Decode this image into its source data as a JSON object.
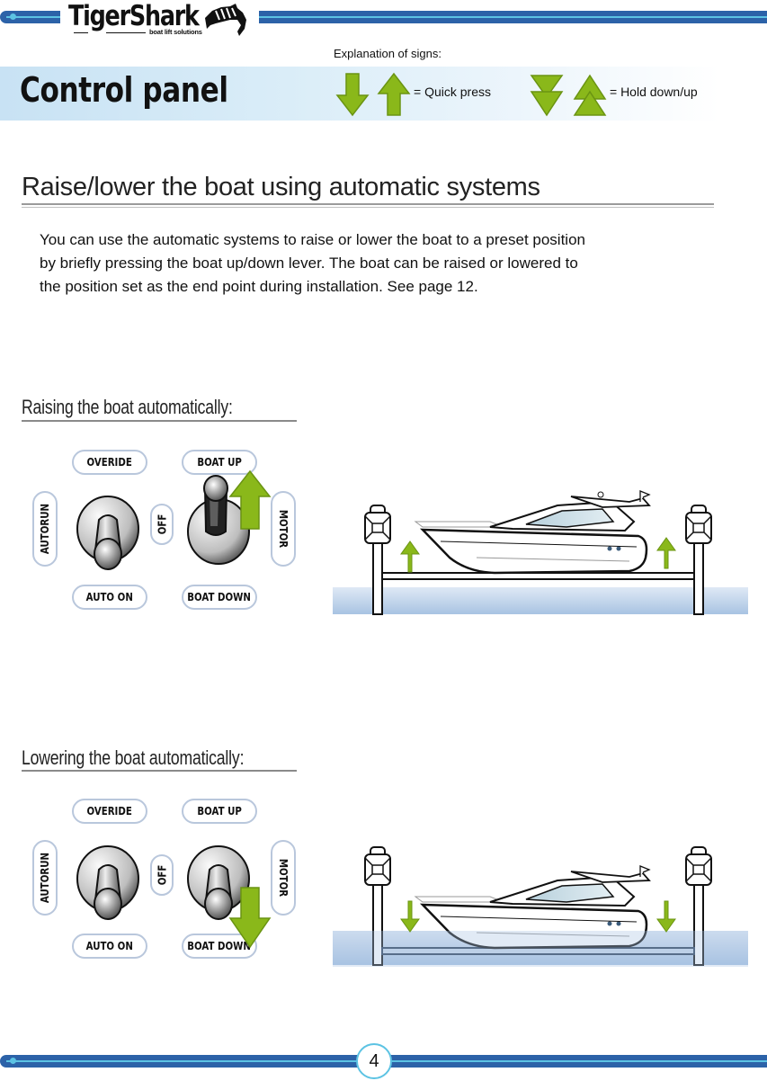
{
  "header": {
    "brand": "TigerShark",
    "tagline": "boat lift solutions",
    "logo_icon": "shark-icon"
  },
  "banner": {
    "title": "Control panel",
    "explanation_label": "Explanation of signs:",
    "legend": [
      {
        "icons": [
          "arrow-down-icon",
          "arrow-up-icon"
        ],
        "label": "= Quick press"
      },
      {
        "icons": [
          "double-arrow-down-icon",
          "double-arrow-up-icon"
        ],
        "label": "= Hold down/up"
      }
    ],
    "arrow_color": "#8ab81a"
  },
  "section": {
    "title": "Raise/lower the boat using automatic systems",
    "body": [
      "You can use the automatic systems to raise or lower the boat to a preset position",
      "by briefly pressing the boat up/down lever.  The boat can be raised or lowered to",
      "the position set as the end point during installation. See page 12."
    ]
  },
  "raising": {
    "title": "Raising  the boat automatically:",
    "panel": {
      "overide": "OVERIDE",
      "boat_up": "BOAT UP",
      "autorun": "AUTORUN",
      "off": "OFF",
      "motor": "MOTOR",
      "auto_on": "AUTO ON",
      "boat_down": "BOAT DOWN"
    },
    "lever_position": "up",
    "arrow": "arrow-up-icon"
  },
  "lowering": {
    "title": "Lowering the boat automatically:",
    "panel": {
      "overide": "OVERIDE",
      "boat_up": "BOAT UP",
      "autorun": "AUTORUN",
      "off": "OFF",
      "motor": "MOTOR",
      "auto_on": "AUTO ON",
      "boat_down": "BOAT DOWN"
    },
    "lever_position": "down",
    "arrow": "arrow-down-icon"
  },
  "footer": {
    "page_number": "4"
  }
}
